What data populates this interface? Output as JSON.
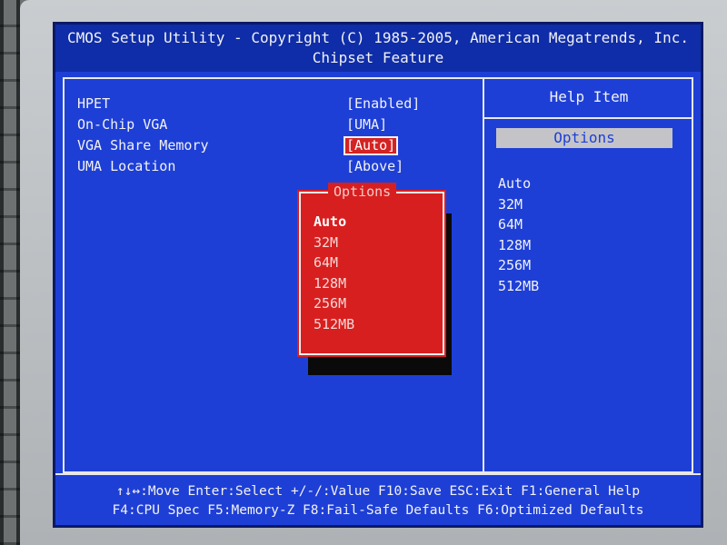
{
  "header": {
    "title": "CMOS Setup Utility - Copyright (C) 1985-2005, American Megatrends, Inc.",
    "subtitle": "Chipset Feature"
  },
  "settings": [
    {
      "label": "HPET",
      "value": "[Enabled]"
    },
    {
      "label": "On-Chip VGA",
      "value": "[UMA]"
    },
    {
      "label": "VGA Share Memory",
      "value": "[Auto]"
    },
    {
      "label": "UMA Location",
      "value": "[Above]"
    }
  ],
  "help": {
    "title": "Help Item",
    "options_label": "Options",
    "options": [
      "Auto",
      "32M",
      "64M",
      "128M",
      "256M",
      "512MB"
    ]
  },
  "popup": {
    "title": "Options",
    "items": [
      "Auto",
      "32M",
      "64M",
      "128M",
      "256M",
      "512MB"
    ]
  },
  "footer": {
    "line1": "↑↓↔:Move  Enter:Select  +/-/:Value  F10:Save  ESC:Exit  F1:General Help",
    "line2": "F4:CPU Spec  F5:Memory-Z  F8:Fail-Safe Defaults  F6:Optimized Defaults"
  },
  "colors": {
    "screen_bg": "#1e3fd6",
    "popup_bg": "#d81f1f",
    "text": "#f2f2f2"
  }
}
